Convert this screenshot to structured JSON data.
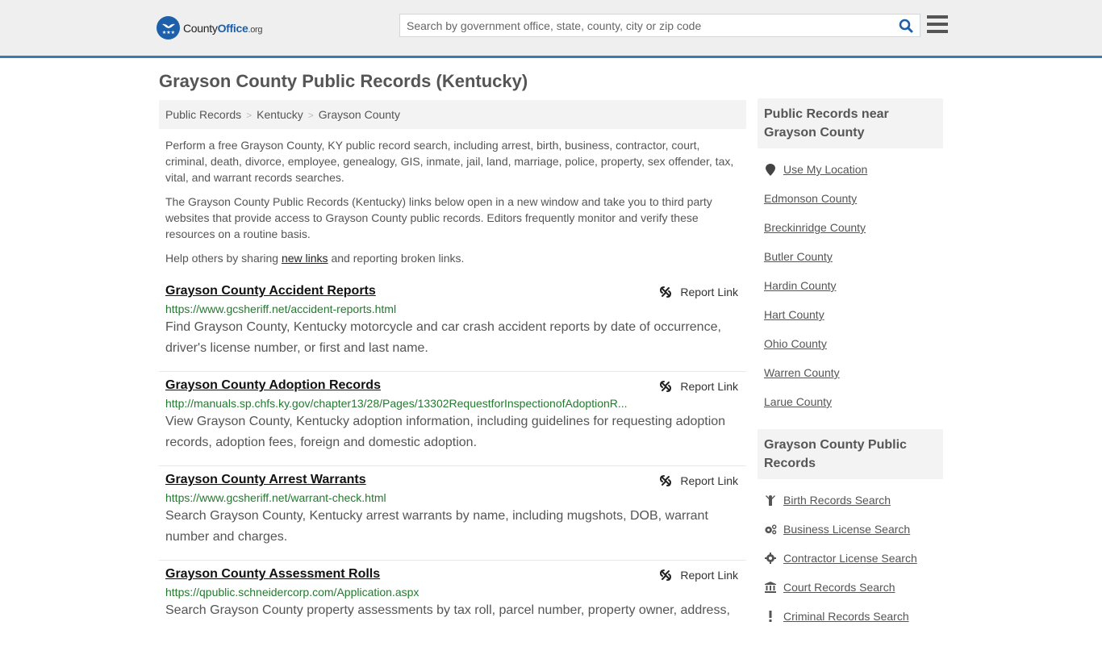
{
  "header": {
    "logo": {
      "part1": "County",
      "part2": "Office",
      "part3": ".org"
    },
    "search_placeholder": "Search by government office, state, county, city or zip code",
    "search_value": "",
    "colors": {
      "brand_blue": "#1d5fa8",
      "accent_bar": "#3a7cb0"
    }
  },
  "page_title": "Grayson County Public Records (Kentucky)",
  "breadcrumb": [
    "Public Records",
    "Kentucky",
    "Grayson County"
  ],
  "intro": {
    "p1": "Perform a free Grayson County, KY public record search, including arrest, birth, business, contractor, court, criminal, death, divorce, employee, genealogy, GIS, inmate, jail, land, marriage, police, property, sex offender, tax, vital, and warrant records searches.",
    "p2": "The Grayson County Public Records (Kentucky) links below open in a new window and take you to third party websites that provide access to Grayson County public records. Editors frequently monitor and verify these resources on a routine basis.",
    "p3_before": "Help others by sharing ",
    "p3_link": "new links",
    "p3_after": " and reporting broken links."
  },
  "report_label": "Report Link",
  "records": [
    {
      "title": "Grayson County Accident Reports",
      "url": "https://www.gcsheriff.net/accident-reports.html",
      "desc": "Find Grayson County, Kentucky motorcycle and car crash accident reports by date of occurrence, driver's license number, or first and last name."
    },
    {
      "title": "Grayson County Adoption Records",
      "url": "http://manuals.sp.chfs.ky.gov/chapter13/28/Pages/13302RequestforInspectionofAdoptionR...",
      "desc": "View Grayson County, Kentucky adoption information, including guidelines for requesting adoption records, adoption fees, foreign and domestic adoption."
    },
    {
      "title": "Grayson County Arrest Warrants",
      "url": "https://www.gcsheriff.net/warrant-check.html",
      "desc": "Search Grayson County, Kentucky arrest warrants by name, including mugshots, DOB, warrant number and charges."
    },
    {
      "title": "Grayson County Assessment Rolls",
      "url": "https://qpublic.schneidercorp.com/Application.aspx",
      "desc": "Search Grayson County property assessments by tax roll, parcel number, property owner, address,"
    }
  ],
  "sidebar": {
    "nearby_heading": "Public Records near Grayson County",
    "use_location": "Use My Location",
    "nearby": [
      "Edmonson County",
      "Breckinridge County",
      "Butler County",
      "Hardin County",
      "Hart County",
      "Ohio County",
      "Warren County",
      "Larue County"
    ],
    "records_heading": "Grayson County Public Records",
    "record_links": [
      {
        "label": "Birth Records Search",
        "icon": "child-icon"
      },
      {
        "label": "Business License Search",
        "icon": "gears-icon"
      },
      {
        "label": "Contractor License Search",
        "icon": "gear-icon"
      },
      {
        "label": "Court Records Search",
        "icon": "courthouse-icon"
      },
      {
        "label": "Criminal Records Search",
        "icon": "exclamation-icon"
      }
    ]
  }
}
